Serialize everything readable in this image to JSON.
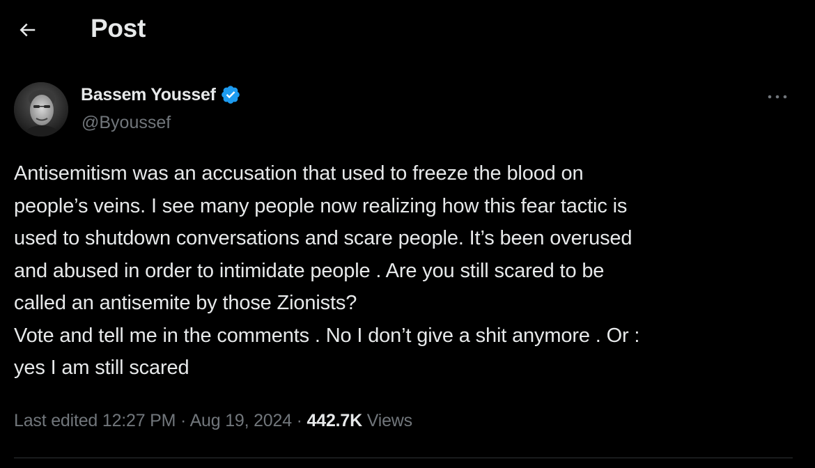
{
  "header": {
    "title": "Post",
    "back_icon": "arrow-left-icon"
  },
  "author": {
    "name": "Bassem Youssef",
    "handle": "@Byoussef",
    "verified": true,
    "verified_color": "#1d9bf0"
  },
  "post": {
    "lines": [
      "Antisemitism was an accusation that used to freeze the blood on",
      "people’s veins. I see many people now realizing how this fear tactic is",
      "used to shutdown conversations and scare people. It’s been overused",
      "and abused in order to intimidate people . Are you still scared to be",
      "called an antisemite by those Zionists?",
      "Vote and tell me in the comments . No I don’t give a shit anymore . Or :",
      "yes I am still scared"
    ]
  },
  "meta": {
    "edited_label": "Last edited",
    "time": "12:27 PM",
    "separator": "·",
    "date": "Aug 19, 2024",
    "views_count": "442.7K",
    "views_label": "Views"
  },
  "colors": {
    "background": "#000000",
    "text_primary": "#e7e9ea",
    "text_secondary": "#71767b",
    "divider": "#2f3336"
  }
}
